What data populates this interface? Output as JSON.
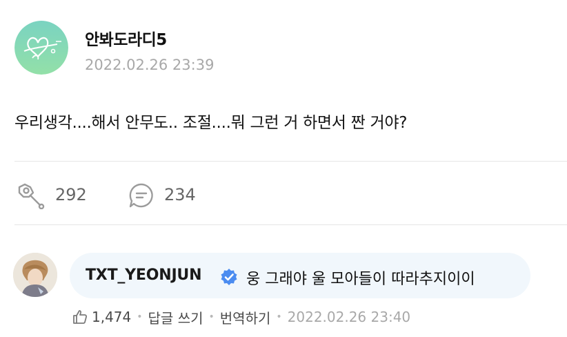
{
  "post": {
    "author": "안봐도라디5",
    "timestamp": "2022.02.26 23:39",
    "body": "우리생각....해서 안무도.. 조절....뭐 그런 거 하면서 짠 거야?",
    "cheer_count": "292",
    "comment_count": "234",
    "avatar_color": "#86d8b0"
  },
  "comment": {
    "author": "TXT_YEONJUN",
    "verified_color": "#4b8cf0",
    "text": "웅 그래야 울 모아들이 따라추지이이",
    "like_count": "1,474",
    "reply_label": "답글 쓰기",
    "translate_label": "번역하기",
    "timestamp": "2022.02.26 23:40",
    "bubble_color": "#f1f7fc"
  },
  "icons": {
    "cheer": "lightstick-icon",
    "comment": "comment-bubble-icon",
    "like": "thumbs-up-icon",
    "verified": "verified-badge-icon"
  }
}
